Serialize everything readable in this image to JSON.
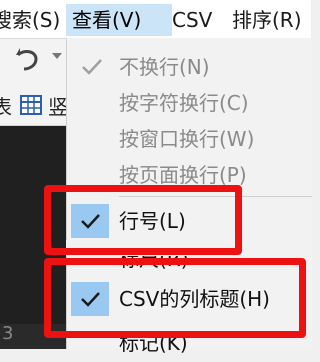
{
  "menubar": {
    "items": [
      {
        "label": "搜索(S)"
      },
      {
        "label": "查看(V)"
      },
      {
        "label": "CSV"
      },
      {
        "label": "排序(R)"
      }
    ]
  },
  "toolbar2": {
    "left_text": "表",
    "right_text": "竖"
  },
  "editor": {
    "line_number": "3"
  },
  "view_menu": {
    "items": [
      {
        "label": "不换行(N)",
        "checked": true,
        "enabled": false
      },
      {
        "label": "按字符换行(C)",
        "checked": false,
        "enabled": false
      },
      {
        "label": "按窗口换行(W)",
        "checked": false,
        "enabled": false
      },
      {
        "label": "按页面换行(P)",
        "checked": false,
        "enabled": false
      },
      {
        "label": "行号(L)",
        "checked": true,
        "enabled": true
      },
      {
        "label": "标尺(R)",
        "checked": false,
        "enabled": true
      },
      {
        "label": "CSV的列标题(H)",
        "checked": true,
        "enabled": true
      },
      {
        "label": "标记(K)",
        "checked": false,
        "enabled": true
      }
    ]
  },
  "colors": {
    "highlight": "#ee1111",
    "active_menu": "#cce4f7",
    "check_bg": "#99c9f0"
  }
}
